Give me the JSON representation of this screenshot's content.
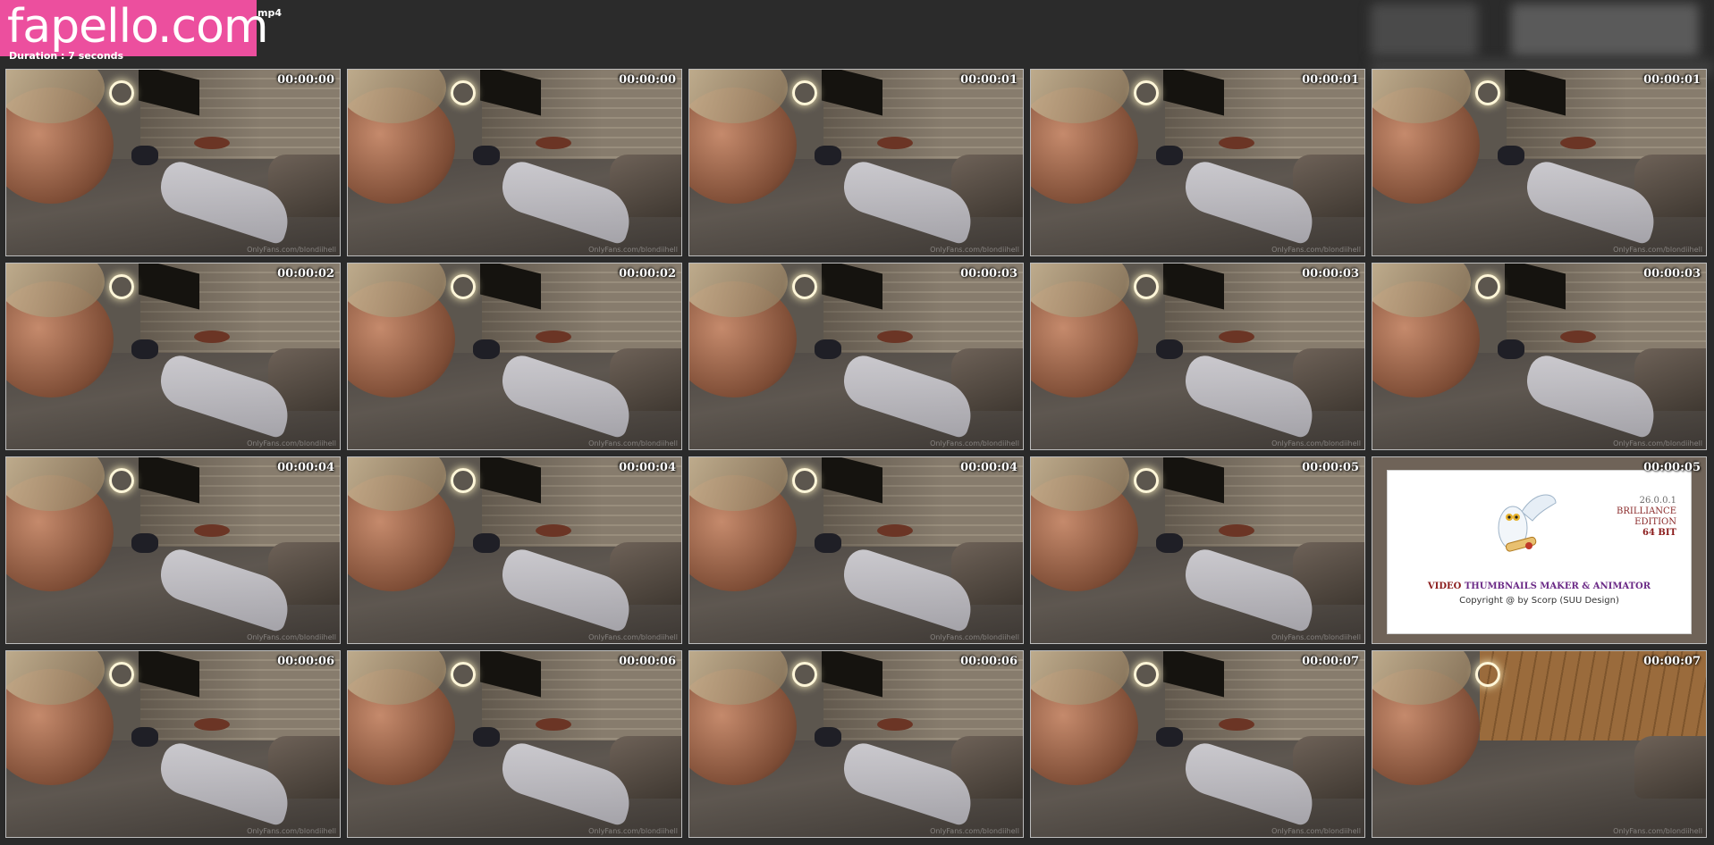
{
  "header": {
    "logo_text": "fapello.com",
    "file_name_fragment": "mp4",
    "duration_line": "Duration :  7 seconds"
  },
  "thumbnails": [
    {
      "timestamp": "00:00:00",
      "watermark": "OnlyFans.com/blondiihell"
    },
    {
      "timestamp": "00:00:00",
      "watermark": "OnlyFans.com/blondiihell"
    },
    {
      "timestamp": "00:00:01",
      "watermark": "OnlyFans.com/blondiihell"
    },
    {
      "timestamp": "00:00:01",
      "watermark": "OnlyFans.com/blondiihell"
    },
    {
      "timestamp": "00:00:01",
      "watermark": "OnlyFans.com/blondiihell"
    },
    {
      "timestamp": "00:00:02",
      "watermark": "OnlyFans.com/blondiihell"
    },
    {
      "timestamp": "00:00:02",
      "watermark": "OnlyFans.com/blondiihell"
    },
    {
      "timestamp": "00:00:03",
      "watermark": "OnlyFans.com/blondiihell"
    },
    {
      "timestamp": "00:00:03",
      "watermark": "OnlyFans.com/blondiihell"
    },
    {
      "timestamp": "00:00:03",
      "watermark": "OnlyFans.com/blondiihell"
    },
    {
      "timestamp": "00:00:04",
      "watermark": "OnlyFans.com/blondiihell"
    },
    {
      "timestamp": "00:00:04",
      "watermark": "OnlyFans.com/blondiihell"
    },
    {
      "timestamp": "00:00:04",
      "watermark": "OnlyFans.com/blondiihell"
    },
    {
      "timestamp": "00:00:05",
      "watermark": "OnlyFans.com/blondiihell"
    },
    {
      "timestamp": "00:00:05",
      "watermark": ""
    },
    {
      "timestamp": "00:00:06",
      "watermark": "OnlyFans.com/blondiihell"
    },
    {
      "timestamp": "00:00:06",
      "watermark": "OnlyFans.com/blondiihell"
    },
    {
      "timestamp": "00:00:06",
      "watermark": "OnlyFans.com/blondiihell"
    },
    {
      "timestamp": "00:00:07",
      "watermark": "OnlyFans.com/blondiihell"
    },
    {
      "timestamp": "00:00:07",
      "watermark": "OnlyFans.com/blondiihell"
    }
  ],
  "brand_card": {
    "version": "26.0.0.1",
    "edition_line1": "BRILLIANCE",
    "edition_line2": "EDITION",
    "bits": "64 BIT",
    "title_first": "VIDEO",
    "title_rest": "THUMBNAILS MAKER & ANIMATOR",
    "copyright": "Copyright @ by Scorp (SUU Design)"
  },
  "colors": {
    "background": "#2a2a2a",
    "logo_bg": "#ec4f9e",
    "thumb_border": "#bdbdbd"
  }
}
